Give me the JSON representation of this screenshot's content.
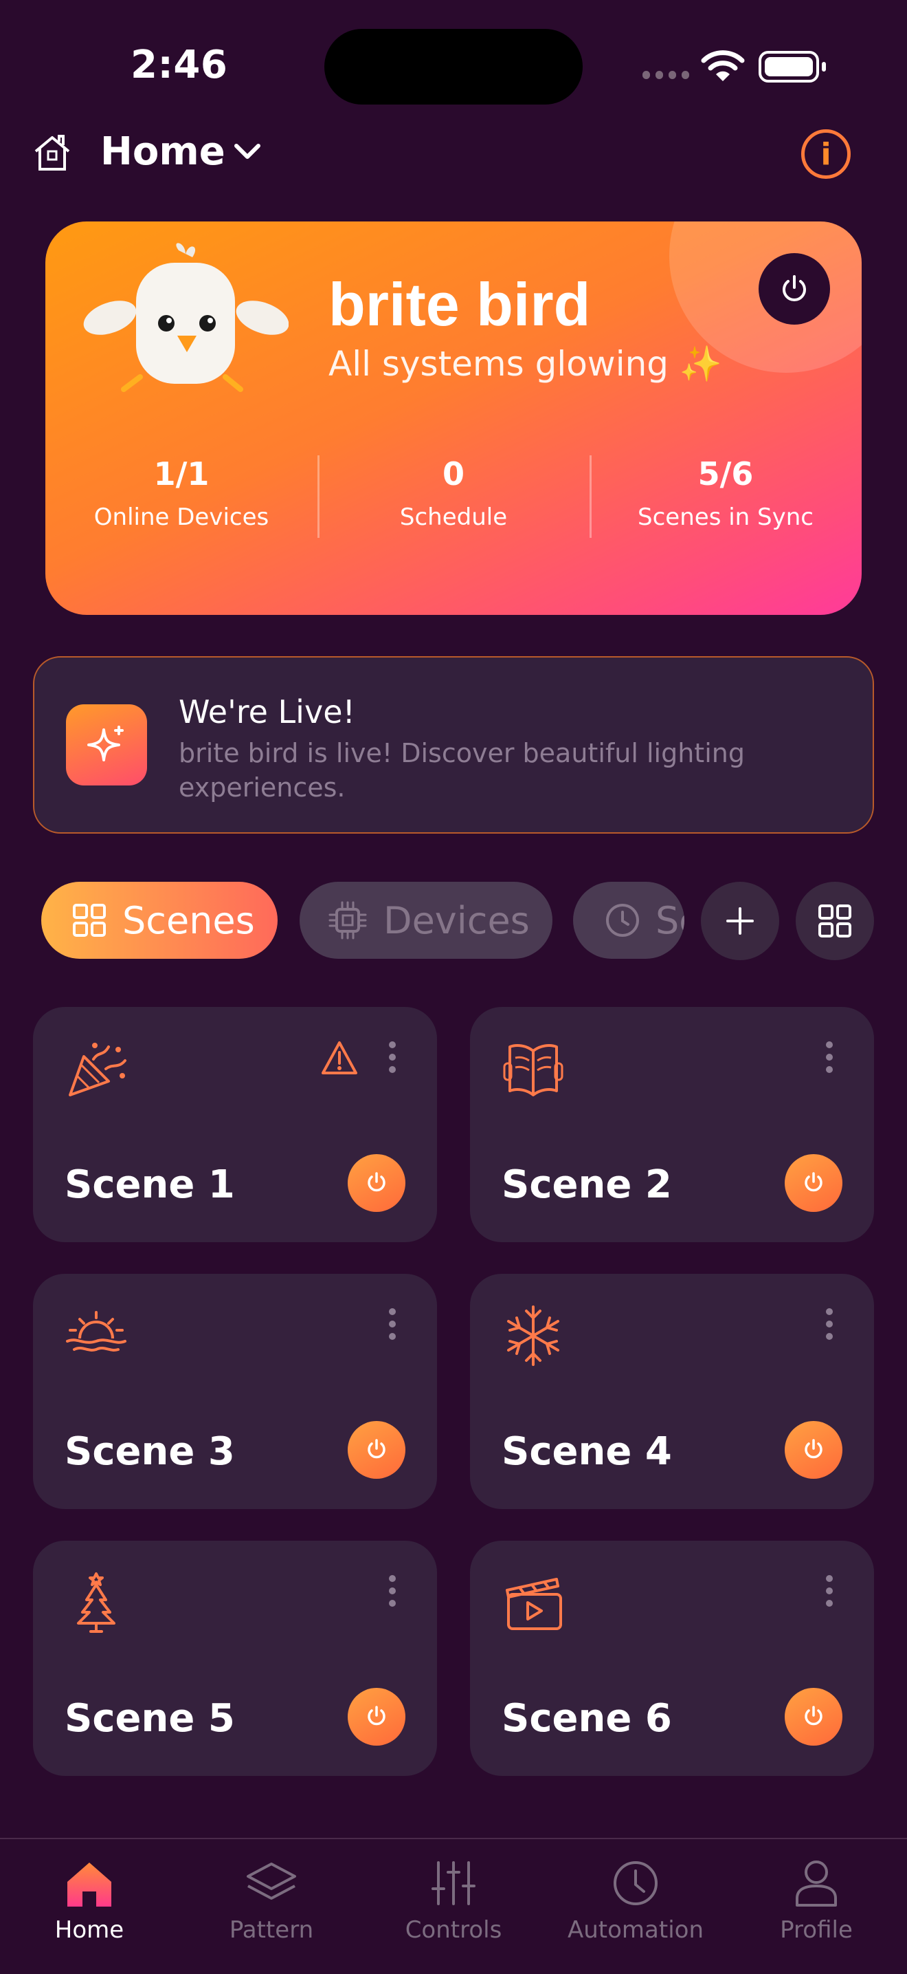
{
  "status_bar": {
    "time": "2:46"
  },
  "header": {
    "title": "Home",
    "home_icon": "house-icon",
    "info_icon": "info-icon"
  },
  "hero": {
    "brand": "brite bird",
    "subtitle": "All systems glowing ✨",
    "stats": [
      {
        "value": "1/1",
        "label": "Online Devices"
      },
      {
        "value": "0",
        "label": "Schedule"
      },
      {
        "value": "5/6",
        "label": "Scenes in Sync"
      }
    ]
  },
  "banner": {
    "title": "We're Live!",
    "body": "brite bird is live! Discover beautiful lighting experiences."
  },
  "tabs": [
    {
      "label": "Scenes",
      "icon": "grid-icon",
      "active": true
    },
    {
      "label": "Devices",
      "icon": "chip-icon",
      "active": false
    },
    {
      "label": "Schedule",
      "icon": "clock-icon",
      "active": false
    }
  ],
  "scenes": [
    {
      "name": "Scene 1",
      "icon": "party-popper-icon",
      "warning": true
    },
    {
      "name": "Scene 2",
      "icon": "book-icon",
      "warning": false
    },
    {
      "name": "Scene 3",
      "icon": "sunrise-icon",
      "warning": false
    },
    {
      "name": "Scene 4",
      "icon": "snowflake-icon",
      "warning": false
    },
    {
      "name": "Scene 5",
      "icon": "tree-icon",
      "warning": false
    },
    {
      "name": "Scene 6",
      "icon": "clapperboard-icon",
      "warning": false
    }
  ],
  "nav": [
    {
      "label": "Home",
      "icon": "home-icon",
      "active": true
    },
    {
      "label": "Pattern",
      "icon": "layers-icon",
      "active": false
    },
    {
      "label": "Controls",
      "icon": "sliders-icon",
      "active": false
    },
    {
      "label": "Automation",
      "icon": "clock-icon",
      "active": false
    },
    {
      "label": "Profile",
      "icon": "person-icon",
      "active": false
    }
  ],
  "colors": {
    "background": "#2a0a2d",
    "accent": "#ff7a3a",
    "card": "#35213d"
  }
}
